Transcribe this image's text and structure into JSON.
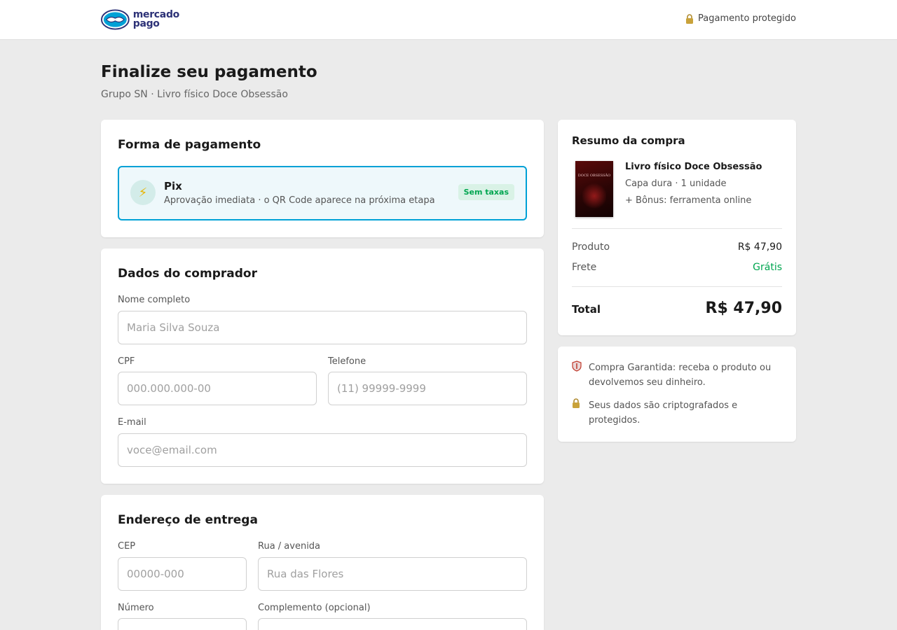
{
  "header": {
    "brand_line1": "mercado",
    "brand_line2": "pago",
    "secure_label": "Pagamento protegido",
    "secure_icon": "lock-icon"
  },
  "page": {
    "title": "Finalize seu pagamento",
    "subtitle": "Grupo SN · Livro físico Doce Obsessão"
  },
  "payment": {
    "title": "Forma de pagamento",
    "method_name": "Pix",
    "method_icon": "lightning-icon",
    "method_desc": "Aprovação imediata · o QR Code aparece na próxima etapa",
    "badge": "Sem taxas"
  },
  "buyer": {
    "title": "Dados do comprador",
    "name_label": "Nome completo",
    "name_placeholder": "Maria Silva Souza",
    "cpf_label": "CPF",
    "cpf_placeholder": "000.000.000-00",
    "phone_label": "Telefone",
    "phone_placeholder": "(11) 99999-9999",
    "email_label": "E-mail",
    "email_placeholder": "voce@email.com"
  },
  "address": {
    "title": "Endereço de entrega",
    "cep_label": "CEP",
    "cep_placeholder": "00000-000",
    "street_label": "Rua / avenida",
    "street_placeholder": "Rua das Flores",
    "number_label": "Número",
    "complement_label": "Complemento (opcional)"
  },
  "summary": {
    "title": "Resumo da compra",
    "product_name": "Livro físico Doce Obsessão",
    "product_detail": "Capa dura · 1 unidade",
    "product_bonus": "+ Bônus: ferramenta online",
    "cover_text": "DOCE OBSESSÃO",
    "product_label": "Produto",
    "product_value": "R$ 47,90",
    "shipping_label": "Frete",
    "shipping_value": "Grátis",
    "total_label": "Total",
    "total_value": "R$ 47,90"
  },
  "trust": {
    "guarantee_icon": "shield-icon",
    "guarantee_text": "Compra Garantida: receba o produto ou devolvemos seu dinheiro.",
    "security_icon": "lock-icon",
    "security_text": "Seus dados são criptografados e protegidos."
  },
  "colors": {
    "accent": "#00a1d6",
    "success": "#00a650",
    "brand": "#2d3277"
  }
}
